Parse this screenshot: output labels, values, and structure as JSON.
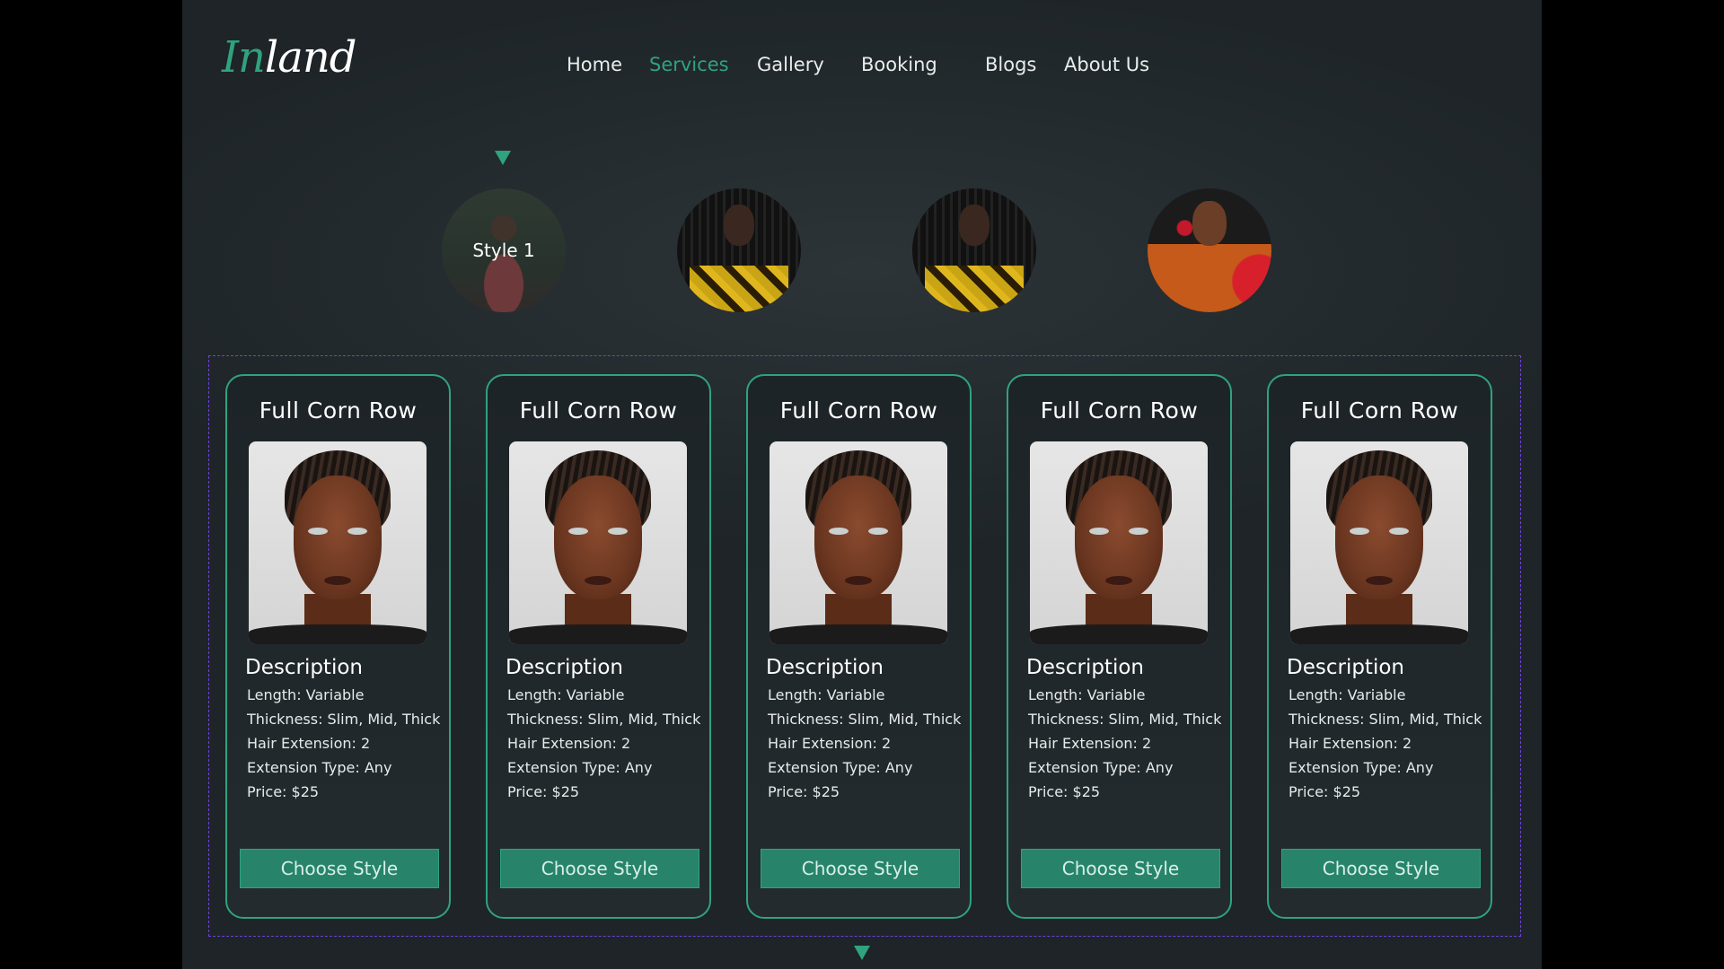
{
  "brand": {
    "logo_accent": "In",
    "logo_rest": "land"
  },
  "nav": {
    "items": [
      {
        "label": "Home"
      },
      {
        "label": "Services"
      },
      {
        "label": "Gallery"
      },
      {
        "label": "Booking"
      },
      {
        "label": "Blogs"
      },
      {
        "label": "About Us"
      }
    ],
    "active": "Services"
  },
  "styles": {
    "selected_label": "Style 1"
  },
  "cards": [
    {
      "title": "Full Corn Row",
      "desc_heading": "Description",
      "length": "Length: Variable",
      "thickness": "Thickness: Slim, Mid, Thick",
      "hair_extension": "Hair Extension: 2",
      "extension_type": "Extension Type: Any",
      "price": "Price: $25",
      "button": "Choose Style"
    },
    {
      "title": "Full Corn Row",
      "desc_heading": "Description",
      "length": "Length: Variable",
      "thickness": "Thickness: Slim, Mid, Thick",
      "hair_extension": "Hair Extension: 2",
      "extension_type": "Extension Type: Any",
      "price": "Price: $25",
      "button": "Choose Style"
    },
    {
      "title": "Full Corn Row",
      "desc_heading": "Description",
      "length": "Length: Variable",
      "thickness": "Thickness: Slim, Mid, Thick",
      "hair_extension": "Hair Extension: 2",
      "extension_type": "Extension Type: Any",
      "price": "Price: $25",
      "button": "Choose Style"
    },
    {
      "title": "Full Corn Row",
      "desc_heading": "Description",
      "length": "Length: Variable",
      "thickness": "Thickness: Slim, Mid, Thick",
      "hair_extension": "Hair Extension: 2",
      "extension_type": "Extension Type: Any",
      "price": "Price: $25",
      "button": "Choose Style"
    },
    {
      "title": "Full Corn Row",
      "desc_heading": "Description",
      "length": "Length: Variable",
      "thickness": "Thickness: Slim, Mid, Thick",
      "hair_extension": "Hair Extension: 2",
      "extension_type": "Extension Type: Any",
      "price": "Price: $25",
      "button": "Choose Style"
    }
  ],
  "colors": {
    "accent": "#2fa37e",
    "button": "#27846a",
    "frame_dash": "#6e43d6",
    "background": "#252d31"
  },
  "icons": {
    "selector_marker": "triangle-down-icon",
    "scroll_marker": "triangle-down-icon"
  }
}
